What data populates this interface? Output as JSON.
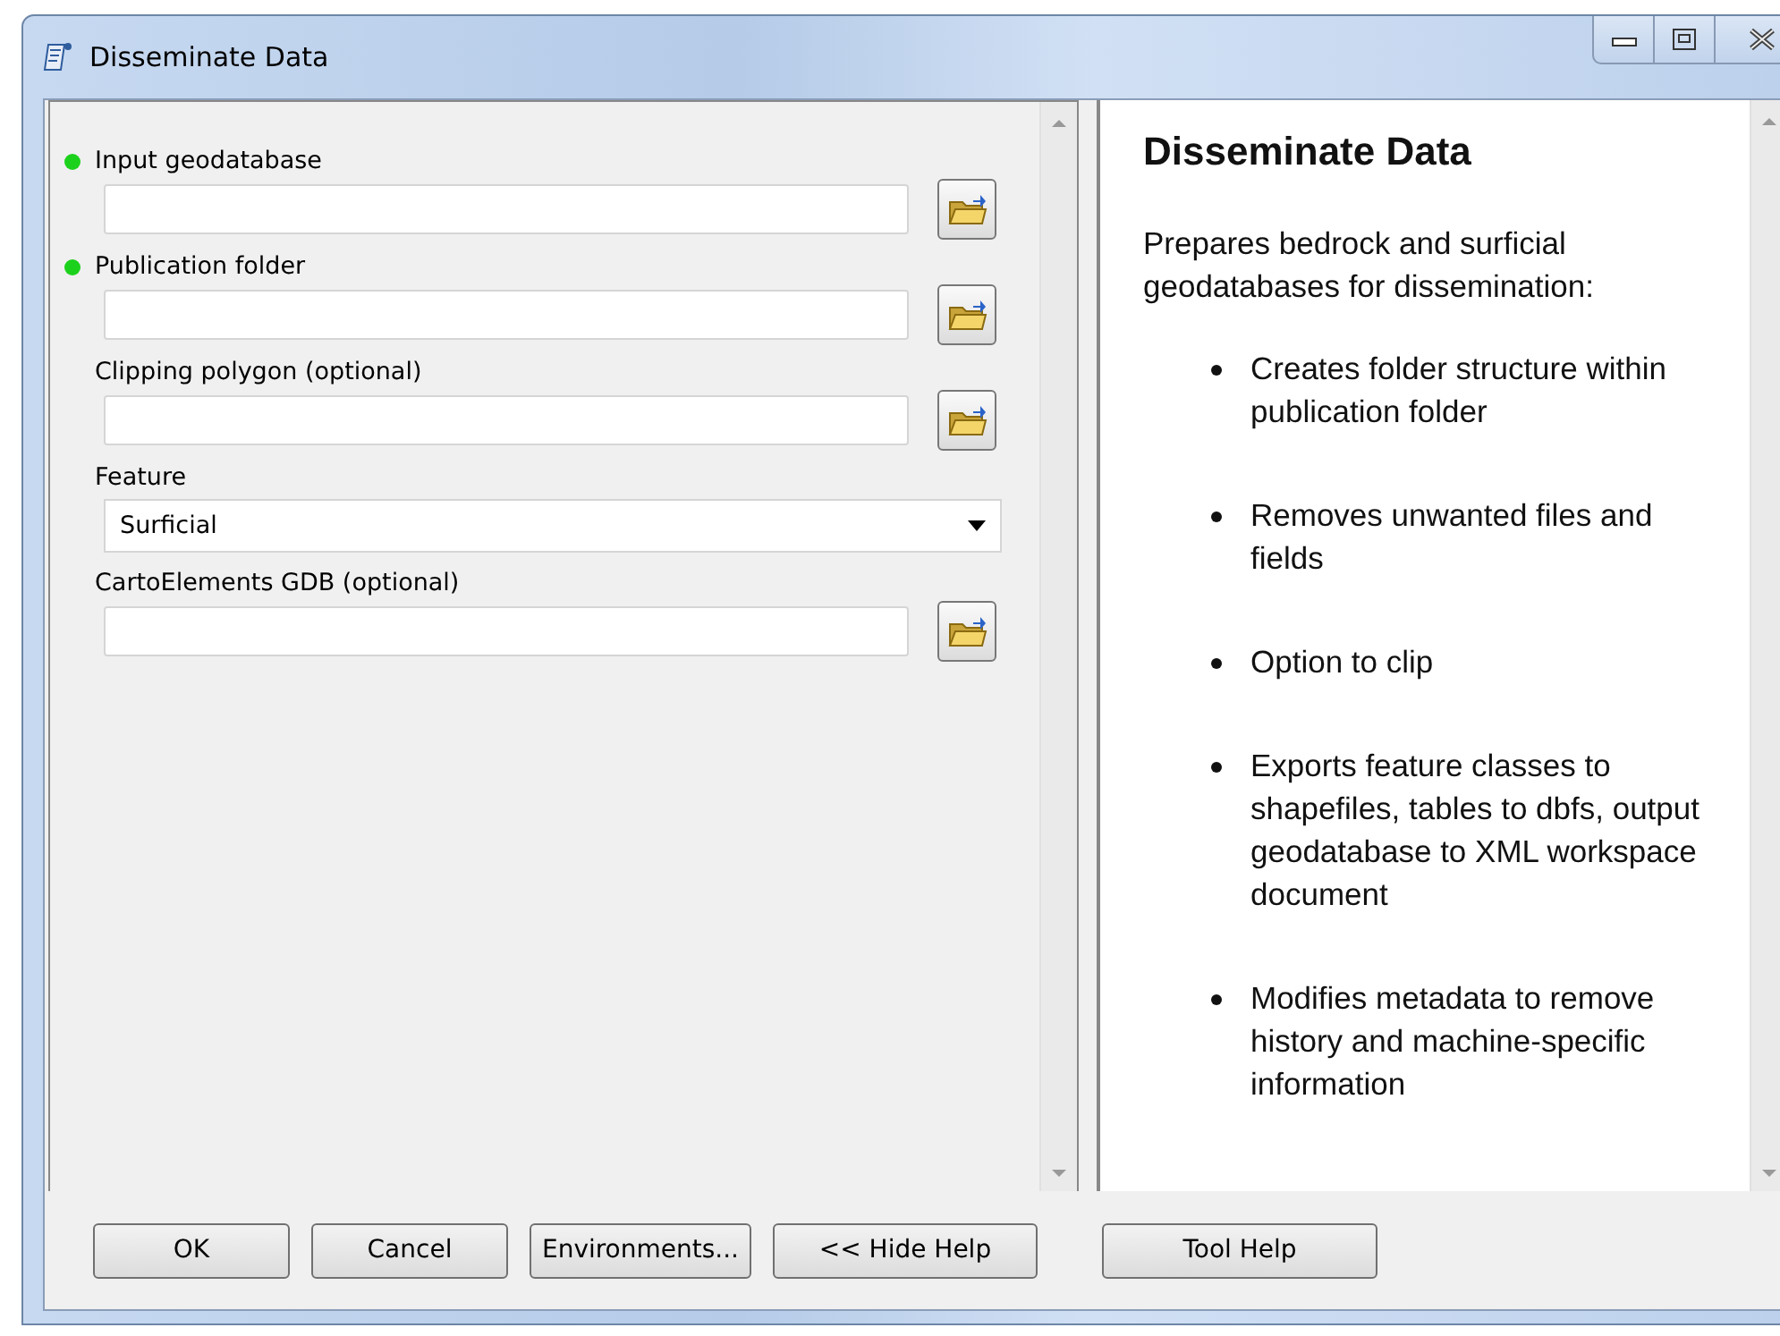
{
  "window": {
    "title": "Disseminate Data"
  },
  "parameters": [
    {
      "label": "Input geodatabase",
      "required": true,
      "kind": "path"
    },
    {
      "label": "Publication folder",
      "required": true,
      "kind": "path"
    },
    {
      "label": "Clipping polygon (optional)",
      "required": false,
      "kind": "path"
    },
    {
      "label": "Feature",
      "required": false,
      "kind": "dropdown",
      "value": "Surficial"
    },
    {
      "label": "CartoElements GDB (optional)",
      "required": false,
      "kind": "path"
    }
  ],
  "help": {
    "title": "Disseminate Data",
    "intro": "Prepares bedrock and surficial geodatabases for dissemination:",
    "bullets": [
      "Creates folder structure within publication folder",
      "Removes unwanted files and fields",
      "Option to clip",
      "Exports feature classes to shapefiles, tables to dbfs, output geodatabase to XML workspace document",
      "Modifies metadata to remove history and machine-specific information"
    ]
  },
  "buttons": [
    "OK",
    "Cancel",
    "Environments...",
    "<< Hide Help",
    "Tool Help"
  ]
}
